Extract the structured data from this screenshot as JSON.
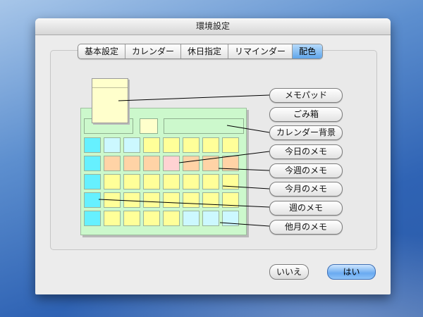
{
  "window": {
    "title": "環境設定"
  },
  "tabs": [
    {
      "label": "基本設定",
      "selected": false
    },
    {
      "label": "カレンダー",
      "selected": false
    },
    {
      "label": "休日指定",
      "selected": false
    },
    {
      "label": "リマインダー",
      "selected": false
    },
    {
      "label": "配色",
      "selected": true
    }
  ],
  "color_items": [
    {
      "label": "メモパッド",
      "swatch": "#ffffcc"
    },
    {
      "label": "ごみ箱",
      "swatch": "#ffffcc"
    },
    {
      "label": "カレンダー背景",
      "swatch": "#ccf8cc"
    },
    {
      "label": "今日のメモ",
      "swatch": "#ffd2d2"
    },
    {
      "label": "今週のメモ",
      "swatch": "#ffd3a6"
    },
    {
      "label": "今月のメモ",
      "swatch": "#ffff99"
    },
    {
      "label": "週のメモ",
      "swatch": "#66f0ff"
    },
    {
      "label": "他月のメモ",
      "swatch": "#ccf8ff"
    }
  ],
  "calendar_preview": {
    "rows": [
      [
        "week",
        "other",
        "other",
        "month",
        "month",
        "month",
        "month",
        "month"
      ],
      [
        "week",
        "thisweek",
        "thisweek",
        "thisweek",
        "today",
        "thisweek",
        "thisweek",
        "thisweek"
      ],
      [
        "week",
        "month",
        "month",
        "month",
        "month",
        "month",
        "month",
        "month"
      ],
      [
        "week",
        "month",
        "month",
        "month",
        "month",
        "month",
        "month",
        "month"
      ],
      [
        "week",
        "month",
        "month",
        "month",
        "month",
        "other",
        "other",
        "other"
      ]
    ]
  },
  "buttons": {
    "cancel": "いいえ",
    "ok": "はい"
  }
}
